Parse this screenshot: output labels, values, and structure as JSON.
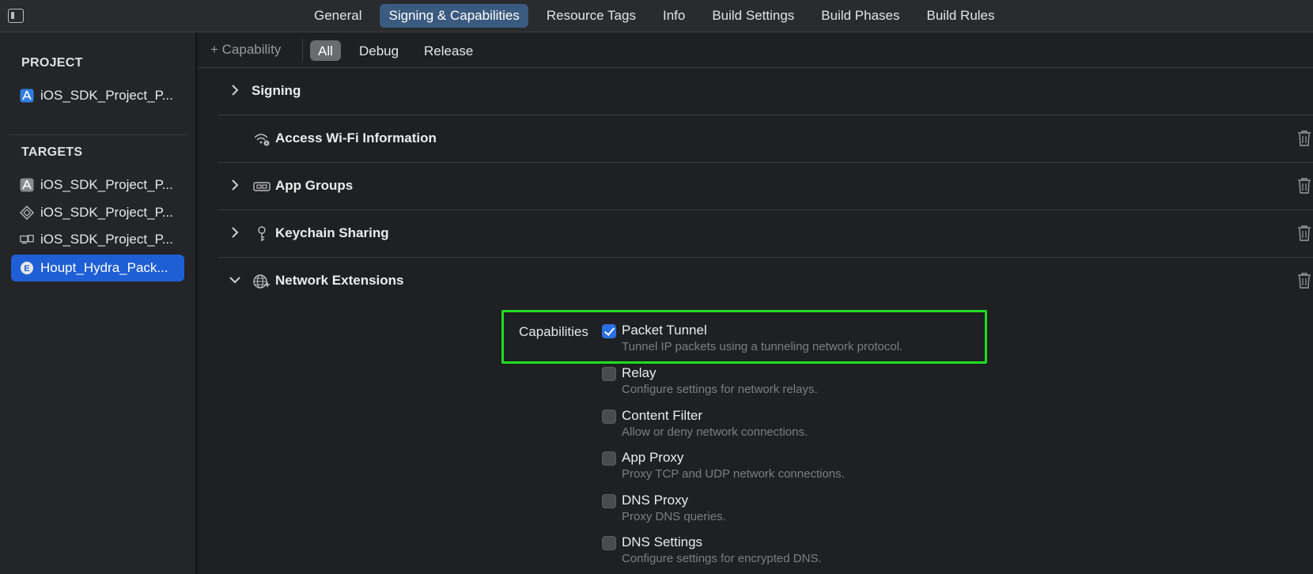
{
  "tabs": [
    "General",
    "Signing & Capabilities",
    "Resource Tags",
    "Info",
    "Build Settings",
    "Build Phases",
    "Build Rules"
  ],
  "active_tab": "Signing & Capabilities",
  "sidebar": {
    "project_header": "PROJECT",
    "project_items": [
      {
        "label": "iOS_SDK_Project_P...",
        "icon": "app-project-icon"
      }
    ],
    "targets_header": "TARGETS",
    "target_items": [
      {
        "label": "iOS_SDK_Project_P...",
        "icon": "app-target-icon"
      },
      {
        "label": "iOS_SDK_Project_P...",
        "icon": "package-target-icon"
      },
      {
        "label": "iOS_SDK_Project_P...",
        "icon": "device-target-icon"
      },
      {
        "label": "Houpt_Hydra_Pack...",
        "icon": "extension-target-icon"
      }
    ],
    "selected_target": "Houpt_Hydra_Pack..."
  },
  "filterbar": {
    "add_capability": "+ Capability",
    "filters": [
      "All",
      "Debug",
      "Release"
    ],
    "active_filter": "All"
  },
  "capabilities": [
    {
      "title": "Signing",
      "icon": "",
      "chevron": "right",
      "deletable": false
    },
    {
      "title": "Access Wi-Fi Information",
      "icon": "wifi-info-icon",
      "chevron": "",
      "deletable": true
    },
    {
      "title": "App Groups",
      "icon": "app-groups-icon",
      "chevron": "right",
      "deletable": true
    },
    {
      "title": "Keychain Sharing",
      "icon": "keychain-icon",
      "chevron": "right",
      "deletable": true
    },
    {
      "title": "Network Extensions",
      "icon": "network-extensions-icon",
      "chevron": "down",
      "deletable": true
    }
  ],
  "network_extensions": {
    "label": "Capabilities",
    "options": [
      {
        "title": "Packet Tunnel",
        "desc": "Tunnel IP packets using a tunneling network protocol.",
        "checked": true
      },
      {
        "title": "Relay",
        "desc": "Configure settings for network relays.",
        "checked": false
      },
      {
        "title": "Content Filter",
        "desc": "Allow or deny network connections.",
        "checked": false
      },
      {
        "title": "App Proxy",
        "desc": "Proxy TCP and UDP network connections.",
        "checked": false
      },
      {
        "title": "DNS Proxy",
        "desc": "Proxy DNS queries.",
        "checked": false
      },
      {
        "title": "DNS Settings",
        "desc": "Configure settings for encrypted DNS.",
        "checked": false
      }
    ]
  },
  "colors": {
    "accent": "#1f5fd6",
    "active_tab_bg": "#3b5a7f",
    "highlight": "#22dd22"
  }
}
